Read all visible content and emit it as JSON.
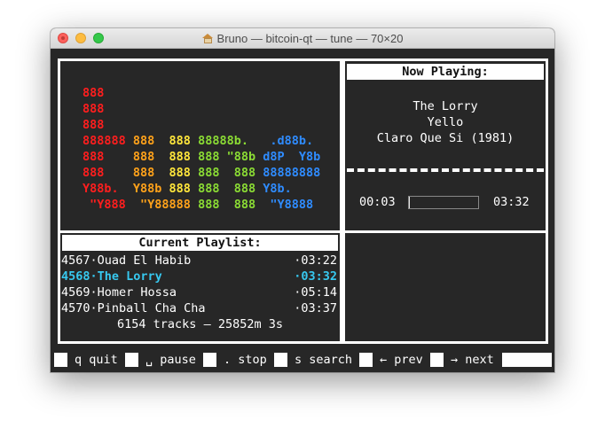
{
  "window": {
    "title": "Bruno — bitcoin-qt — tune — 70×20"
  },
  "colors": {
    "red": "#ff1e1e",
    "orange": "#ffa21a",
    "yellow": "#ffe63b",
    "green": "#8bdc34",
    "blue": "#2f8cff",
    "accent": "#37c8ef"
  },
  "logo": {
    "lines": [
      [
        {
          "t": "888",
          "c": "red"
        }
      ],
      [
        {
          "t": "888",
          "c": "red"
        }
      ],
      [
        {
          "t": "888",
          "c": "red"
        }
      ],
      [
        {
          "t": "888888 ",
          "c": "red"
        },
        {
          "t": "888  ",
          "c": "orange"
        },
        {
          "t": "888 ",
          "c": "yellow"
        },
        {
          "t": "88888b.   ",
          "c": "green"
        },
        {
          "t": ".d88b.",
          "c": "blue"
        }
      ],
      [
        {
          "t": "888    ",
          "c": "red"
        },
        {
          "t": "888  ",
          "c": "orange"
        },
        {
          "t": "888 ",
          "c": "yellow"
        },
        {
          "t": "888 \"88b ",
          "c": "green"
        },
        {
          "t": "d8P  Y8b",
          "c": "blue"
        }
      ],
      [
        {
          "t": "888    ",
          "c": "red"
        },
        {
          "t": "888  ",
          "c": "orange"
        },
        {
          "t": "888 ",
          "c": "yellow"
        },
        {
          "t": "888  888 ",
          "c": "green"
        },
        {
          "t": "88888888",
          "c": "blue"
        }
      ],
      [
        {
          "t": "Y88b.  ",
          "c": "red"
        },
        {
          "t": "Y88b ",
          "c": "orange"
        },
        {
          "t": "888 ",
          "c": "yellow"
        },
        {
          "t": "888  888 ",
          "c": "green"
        },
        {
          "t": "Y8b.",
          "c": "blue"
        }
      ],
      [
        {
          "t": " \"Y888  ",
          "c": "red"
        },
        {
          "t": "\"Y88888 ",
          "c": "orange"
        },
        {
          "t": "888  888  ",
          "c": "green"
        },
        {
          "t": "\"Y8888",
          "c": "blue"
        }
      ]
    ]
  },
  "now_playing": {
    "header": "Now Playing:",
    "title": "The Lorry",
    "artist": "Yello",
    "album": "Claro Que Si (1981)",
    "elapsed": "00:03",
    "total": "03:32",
    "progress": 0.014
  },
  "playlist": {
    "header": "Current Playlist:",
    "tracks": [
      {
        "label": "4567·Ouad El Habib",
        "duration": "·03:22",
        "current": false
      },
      {
        "label": "4568·The Lorry",
        "duration": "·03:32",
        "current": true
      },
      {
        "label": "4569·Homer Hossa",
        "duration": "·05:14",
        "current": false
      },
      {
        "label": "4570·Pinball Cha Cha",
        "duration": "·03:37",
        "current": false
      }
    ],
    "summary": "6154 tracks — 25852m 3s"
  },
  "keys": {
    "quit": "q quit",
    "pause": "␣ pause",
    "stop": ". stop",
    "search": "s search",
    "prev": "← prev",
    "next": "→ next"
  }
}
